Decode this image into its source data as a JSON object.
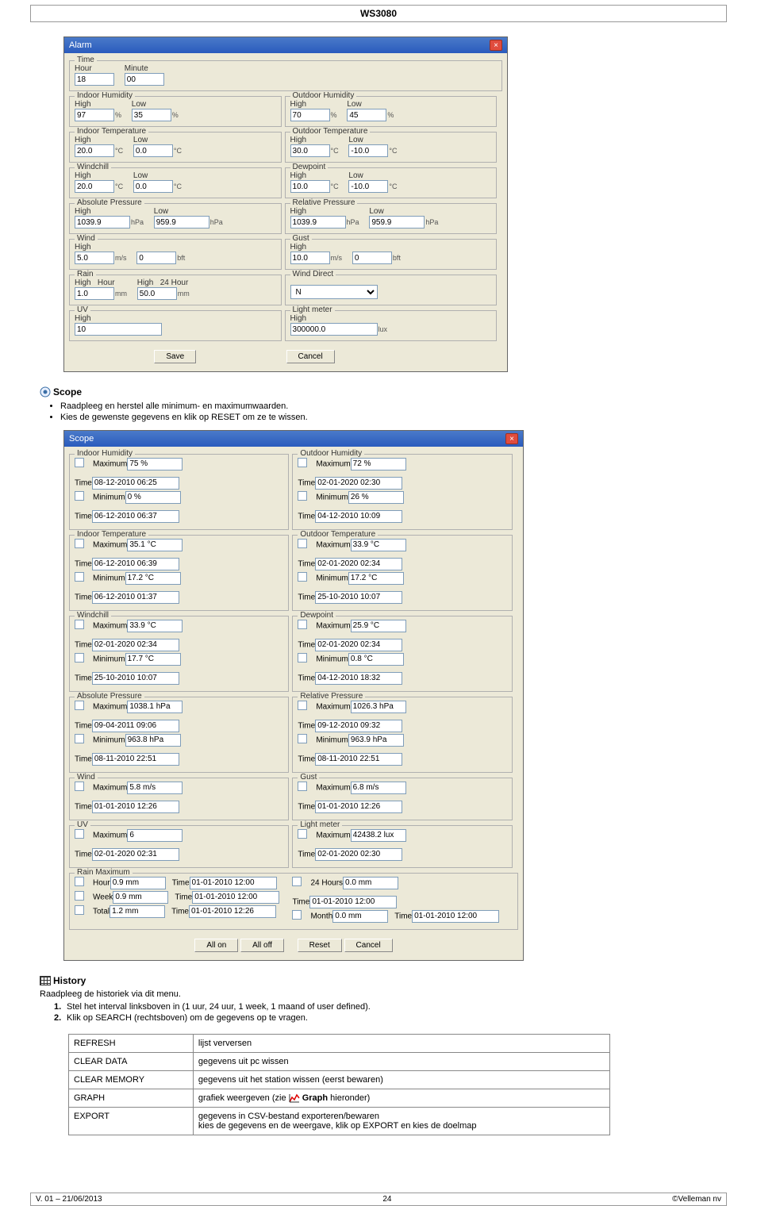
{
  "header_title": "WS3080",
  "alarm": {
    "title": "Alarm",
    "time": {
      "legend": "Time",
      "hour_label": "Hour",
      "hour": "18",
      "minute_label": "Minute",
      "minute": "00"
    },
    "indoor_humidity": {
      "legend": "Indoor Humidity",
      "high_label": "High",
      "high": "97",
      "low_label": "Low",
      "low": "35",
      "unit": "%"
    },
    "outdoor_humidity": {
      "legend": "Outdoor Humidity",
      "high_label": "High",
      "high": "70",
      "low_label": "Low",
      "low": "45",
      "unit": "%"
    },
    "indoor_temp": {
      "legend": "Indoor Temperature",
      "high_label": "High",
      "high": "20.0",
      "low_label": "Low",
      "low": "0.0",
      "unit": "°C"
    },
    "outdoor_temp": {
      "legend": "Outdoor Temperature",
      "high_label": "High",
      "high": "30.0",
      "low_label": "Low",
      "low": "-10.0",
      "unit": "°C"
    },
    "windchill": {
      "legend": "Windchill",
      "high_label": "High",
      "high": "20.0",
      "low_label": "Low",
      "low": "0.0",
      "unit": "°C"
    },
    "dewpoint": {
      "legend": "Dewpoint",
      "high_label": "High",
      "high": "10.0",
      "low_label": "Low",
      "low": "-10.0",
      "unit": "°C"
    },
    "abs_pressure": {
      "legend": "Absolute Pressure",
      "high_label": "High",
      "high": "1039.9",
      "low_label": "Low",
      "low": "959.9",
      "unit": "hPa"
    },
    "rel_pressure": {
      "legend": "Relative Pressure",
      "high_label": "High",
      "high": "1039.9",
      "low_label": "Low",
      "low": "959.9",
      "unit": "hPa"
    },
    "wind": {
      "legend": "Wind",
      "high_label": "High",
      "high": "5.0",
      "unitA": "m/s",
      "low": "0",
      "unitB": "bft"
    },
    "gust": {
      "legend": "Gust",
      "high_label": "High",
      "high": "10.0",
      "unitA": "m/s",
      "low": "0",
      "unitB": "bft"
    },
    "rain": {
      "legend": "Rain",
      "high_label": "High",
      "hour_label": "Hour",
      "hour": "1.0",
      "high_24_label": "High",
      "tf_label": "24 Hour",
      "tf": "50.0",
      "unit": "mm"
    },
    "wind_direct": {
      "legend": "Wind Direct",
      "val": "N"
    },
    "uv": {
      "legend": "UV",
      "high_label": "High",
      "high": "10"
    },
    "light": {
      "legend": "Light meter",
      "high_label": "High",
      "high": "300000.0",
      "unit": "lux"
    },
    "buttons": {
      "save": "Save",
      "cancel": "Cancel"
    }
  },
  "scope_section": {
    "heading": "Scope",
    "bullets": [
      "Raadpleeg en herstel alle minimum- en maximumwaarden.",
      "Kies de gewenste gegevens en klik op RESET om ze te wissen."
    ]
  },
  "scope": {
    "title": "Scope",
    "labels": {
      "max": "Maximum",
      "min": "Minimum",
      "time": "Time"
    },
    "indoor_humidity": {
      "legend": "Indoor Humidity",
      "max": "75 %",
      "max_time": "08-12-2010 06:25",
      "min": "0 %",
      "min_time": "06-12-2010 06:37"
    },
    "outdoor_humidity": {
      "legend": "Outdoor Humidity",
      "max": "72 %",
      "max_time": "02-01-2020 02:30",
      "min": "26 %",
      "min_time": "04-12-2010 10:09"
    },
    "indoor_temp": {
      "legend": "Indoor Temperature",
      "max": "35.1 °C",
      "max_time": "06-12-2010 06:39",
      "min": "17.2 °C",
      "min_time": "06-12-2010 01:37"
    },
    "outdoor_temp": {
      "legend": "Outdoor Temperature",
      "max": "33.9 °C",
      "max_time": "02-01-2020 02:34",
      "min": "17.2 °C",
      "min_time": "25-10-2010 10:07"
    },
    "windchill": {
      "legend": "Windchill",
      "max": "33.9 °C",
      "max_time": "02-01-2020 02:34",
      "min": "17.7 °C",
      "min_time": "25-10-2010 10:07"
    },
    "dewpoint": {
      "legend": "Dewpoint",
      "max": "25.9 °C",
      "max_time": "02-01-2020 02:34",
      "min": "0.8 °C",
      "min_time": "04-12-2010 18:32"
    },
    "abs_pressure": {
      "legend": "Absolute Pressure",
      "max": "1038.1 hPa",
      "max_time": "09-04-2011 09:06",
      "min": "963.8 hPa",
      "min_time": "08-11-2010 22:51"
    },
    "rel_pressure": {
      "legend": "Relative Pressure",
      "max": "1026.3 hPa",
      "max_time": "09-12-2010 09:32",
      "min": "963.9 hPa",
      "min_time": "08-11-2010 22:51"
    },
    "wind": {
      "legend": "Wind",
      "max": "5.8 m/s",
      "max_time": "01-01-2010 12:26"
    },
    "gust": {
      "legend": "Gust",
      "max": "6.8 m/s",
      "max_time": "01-01-2010 12:26"
    },
    "uv": {
      "legend": "UV",
      "max": "6",
      "max_time": "02-01-2020 02:31"
    },
    "light": {
      "legend": "Light meter",
      "max": "42438.2 lux",
      "max_time": "02-01-2020 02:30"
    },
    "rain": {
      "legend": "Rain Maximum",
      "hour_label": "Hour",
      "hour": "0.9 mm",
      "hour_time": "01-01-2010 12:00",
      "h24_label": "24 Hours",
      "h24": "0.0 mm",
      "h24_time": "01-01-2010 12:00",
      "week_label": "Week",
      "week": "0.9 mm",
      "week_time": "01-01-2010 12:00",
      "month_label": "Month",
      "month": "0.0 mm",
      "month_time": "01-01-2010 12:00",
      "total_label": "Total",
      "total": "1.2 mm",
      "total_time": "01-01-2010 12:26"
    },
    "buttons": {
      "allon": "All on",
      "alloff": "All off",
      "reset": "Reset",
      "cancel": "Cancel"
    }
  },
  "history_section": {
    "heading": "History",
    "text": "Raadpleeg de historiek via dit menu.",
    "steps": [
      "Stel het interval linksboven in (1 uur, 24 uur, 1 week, 1 maand of user defined).",
      "Klik op SEARCH (rechtsboven) om de gegevens op te vragen."
    ]
  },
  "table": {
    "rows": [
      {
        "key": "REFRESH",
        "val": "lijst verversen"
      },
      {
        "key": "CLEAR DATA",
        "val": "gegevens uit pc wissen"
      },
      {
        "key": "CLEAR MEMORY",
        "val": "gegevens uit het station wissen (eerst bewaren)"
      },
      {
        "key": "GRAPH",
        "val_a": "grafiek weergeven (zie ",
        "bold": "Graph",
        "val_b": " hieronder)"
      },
      {
        "key": "EXPORT",
        "val": "gegevens in CSV-bestand exporteren/bewaren\nkies de gegevens en de weergave, klik op EXPORT en kies de doelmap"
      }
    ]
  },
  "footer": {
    "left": "V. 01 – 21/06/2013",
    "mid": "24",
    "right": "©Velleman nv"
  }
}
